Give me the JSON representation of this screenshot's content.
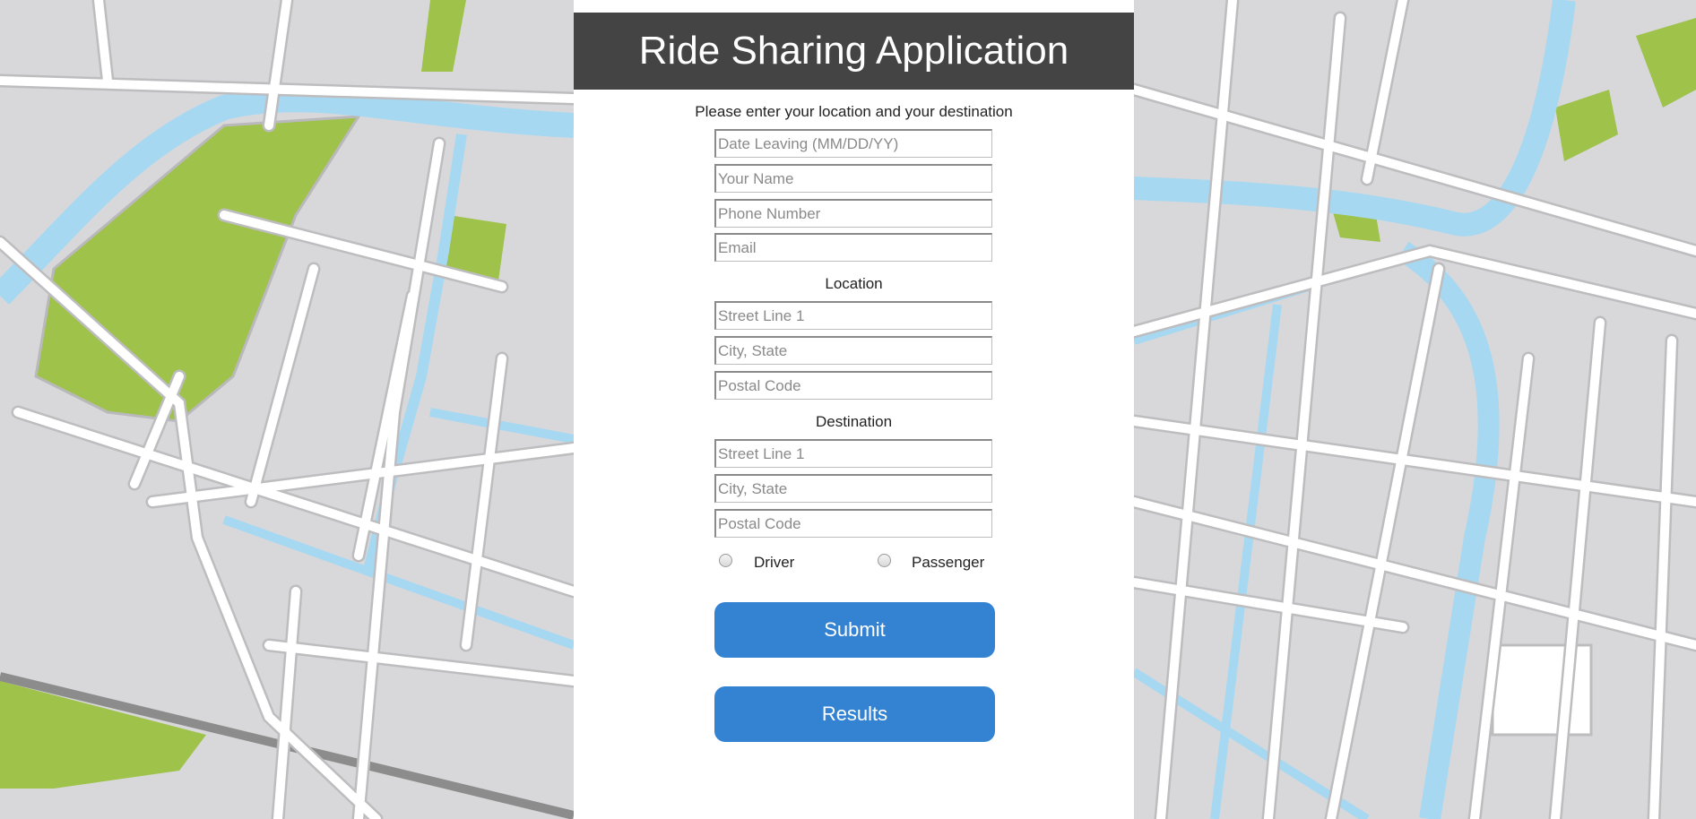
{
  "app": {
    "title": "Ride Sharing Application",
    "intro": "Please enter your location and your destination"
  },
  "personal": {
    "date_placeholder": "Date Leaving (MM/DD/YY)",
    "name_placeholder": "Your Name",
    "phone_placeholder": "Phone Number",
    "email_placeholder": "Email"
  },
  "location": {
    "label": "Location",
    "street_placeholder": "Street Line 1",
    "city_placeholder": "City, State",
    "postal_placeholder": "Postal Code"
  },
  "destination": {
    "label": "Destination",
    "street_placeholder": "Street Line 1",
    "city_placeholder": "City, State",
    "postal_placeholder": "Postal Code"
  },
  "role": {
    "driver_label": "Driver",
    "passenger_label": "Passenger"
  },
  "actions": {
    "submit_label": "Submit",
    "results_label": "Results"
  },
  "colors": {
    "header_bg": "#444444",
    "button_bg": "#3383d2",
    "map_block": "#d8d8da",
    "map_road": "#ffffff",
    "map_water": "#a6d8f2",
    "map_park": "#9ec24a"
  },
  "icons": {
    "map_background": "city-street-map"
  }
}
